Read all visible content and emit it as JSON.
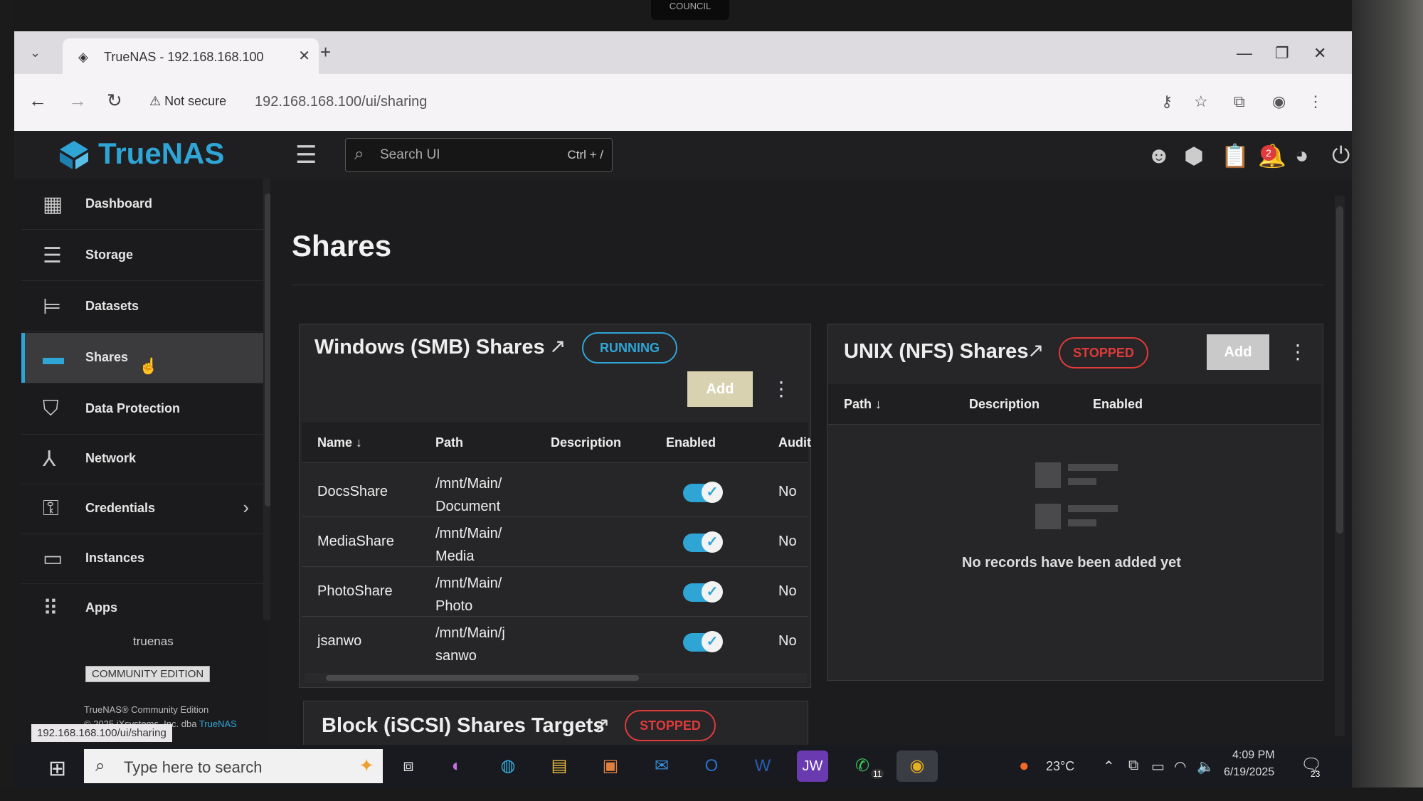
{
  "webcam": {
    "label": "COUNCIL"
  },
  "browser": {
    "tab_title": "TrueNAS - 192.168.168.100",
    "security": "Not secure",
    "url": "192.168.168.100/ui/sharing"
  },
  "header": {
    "logo": "TrueNAS",
    "search_placeholder": "Search UI",
    "search_shortcut": "Ctrl + /",
    "notification_count": "2"
  },
  "sidebar": {
    "items": [
      {
        "label": "Dashboard",
        "icon": "dashboard-icon"
      },
      {
        "label": "Storage",
        "icon": "storage-icon"
      },
      {
        "label": "Datasets",
        "icon": "datasets-icon"
      },
      {
        "label": "Shares",
        "icon": "shares-icon"
      },
      {
        "label": "Data Protection",
        "icon": "shield-icon"
      },
      {
        "label": "Network",
        "icon": "network-icon"
      },
      {
        "label": "Credentials",
        "icon": "key-icon"
      },
      {
        "label": "Instances",
        "icon": "laptop-icon"
      },
      {
        "label": "Apps",
        "icon": "apps-grid-icon"
      }
    ],
    "active": "Shares",
    "hostname": "truenas",
    "edition": "COMMUNITY EDITION",
    "copyright_line1": "TrueNAS® Community Edition",
    "copyright_line2": "© 2025 iXsystems, Inc. dba",
    "copyright_link": "TrueNAS"
  },
  "status_bar_url": "192.168.168.100/ui/sharing",
  "main": {
    "title": "Shares",
    "smb": {
      "title": "Windows (SMB) Shares",
      "status": "RUNNING",
      "add_label": "Add",
      "columns": [
        "Name",
        "Path",
        "Description",
        "Enabled",
        "Audit"
      ],
      "rows": [
        {
          "name": "DocsShare",
          "path_line1": "/mnt/Main/",
          "path_line2": "Document",
          "enabled": true,
          "audit": "No"
        },
        {
          "name": "MediaShare",
          "path_line1": "/mnt/Main/",
          "path_line2": "Media",
          "enabled": true,
          "audit": "No"
        },
        {
          "name": "PhotoShare",
          "path_line1": "/mnt/Main/",
          "path_line2": "Photo",
          "enabled": true,
          "audit": "No"
        },
        {
          "name": "jsanwo",
          "path_line1": "/mnt/Main/j",
          "path_line2": "sanwo",
          "enabled": true,
          "audit": "No"
        }
      ]
    },
    "nfs": {
      "title": "UNIX (NFS) Shares",
      "status": "STOPPED",
      "add_label": "Add",
      "columns": [
        "Path",
        "Description",
        "Enabled"
      ],
      "empty_message": "No records have been added yet"
    },
    "iscsi": {
      "title": "Block (iSCSI) Shares Targets",
      "status": "STOPPED"
    }
  },
  "taskbar": {
    "search_placeholder": "Type here to search",
    "temperature": "23°C",
    "time": "4:09 PM",
    "date": "6/19/2025",
    "whatsapp_badge": "11",
    "notif_count": "23",
    "app_jw": "JW"
  },
  "colors": {
    "accent": "#2fa5d6",
    "running": "#2fa5d6",
    "stopped": "#e03a3a"
  }
}
